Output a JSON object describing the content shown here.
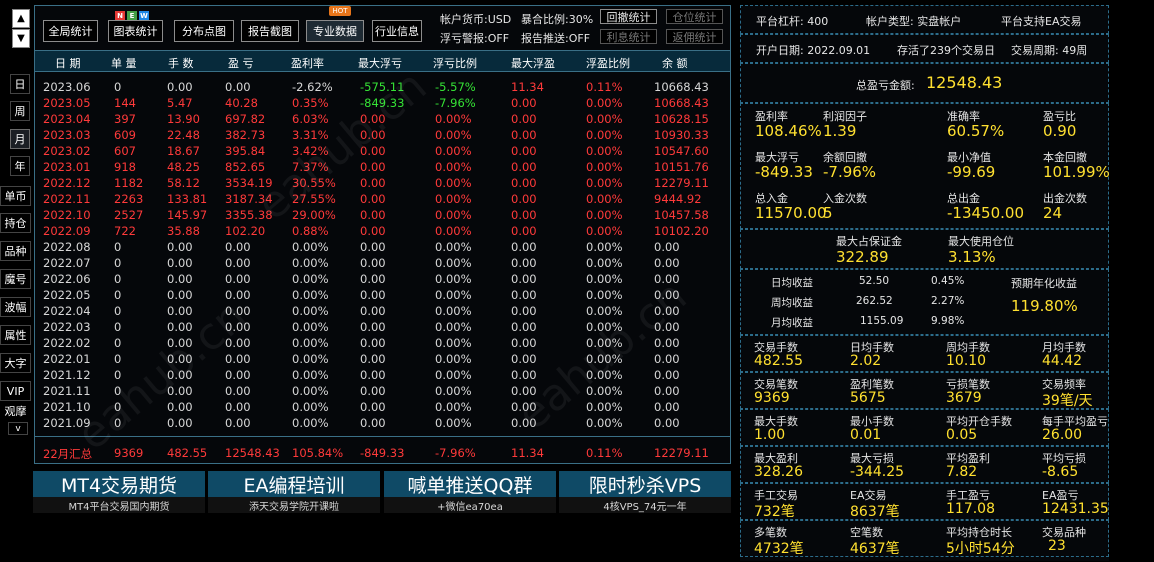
{
  "nav": {
    "up": "▲",
    "down": "▼",
    "period": [
      "日",
      "周",
      "月",
      "年"
    ],
    "tools": [
      "单币",
      "持仓",
      "品种",
      "魔号",
      "波幅",
      "属性",
      "大字",
      "VIP",
      "观摩"
    ],
    "more": "v"
  },
  "toolbar": {
    "buttons": [
      "全局统计",
      "图表统计",
      "分布点图",
      "报告截图",
      "专业数据",
      "行业信息"
    ],
    "new_badge": [
      "N",
      "E",
      "W"
    ],
    "hot_badge": "HOT",
    "currency": "帐户货币:USD",
    "expose": "暴合比例:30%",
    "float_warn": "浮亏警报:OFF",
    "report_push": "报告推送:OFF",
    "btn_drawdown": "回撤统计",
    "btn_position": "仓位统计",
    "btn_interest": "利息统计",
    "btn_rebate": "返佣统计"
  },
  "table": {
    "headers": [
      "日 期",
      "单 量",
      "手 数",
      "盈 亏",
      "盈利率",
      "最大浮亏",
      "浮亏比例",
      "最大浮盈",
      "浮盈比例",
      "余 额"
    ],
    "rows": [
      [
        "2023.06",
        "0",
        "0.00",
        "0.00",
        "-2.62%",
        "-575.11",
        "-5.57%",
        "11.34",
        "0.11%",
        "10668.43"
      ],
      [
        "2023.05",
        "144",
        "5.47",
        "40.28",
        "0.35%",
        "-849.33",
        "-7.96%",
        "0.00",
        "0.00%",
        "10668.43"
      ],
      [
        "2023.04",
        "397",
        "13.90",
        "697.82",
        "6.03%",
        "0.00",
        "0.00%",
        "0.00",
        "0.00%",
        "10628.15"
      ],
      [
        "2023.03",
        "609",
        "22.48",
        "382.73",
        "3.31%",
        "0.00",
        "0.00%",
        "0.00",
        "0.00%",
        "10930.33"
      ],
      [
        "2023.02",
        "607",
        "18.67",
        "395.84",
        "3.42%",
        "0.00",
        "0.00%",
        "0.00",
        "0.00%",
        "10547.60"
      ],
      [
        "2023.01",
        "918",
        "48.25",
        "852.65",
        "7.37%",
        "0.00",
        "0.00%",
        "0.00",
        "0.00%",
        "10151.76"
      ],
      [
        "2022.12",
        "1182",
        "58.12",
        "3534.19",
        "30.55%",
        "0.00",
        "0.00%",
        "0.00",
        "0.00%",
        "12279.11"
      ],
      [
        "2022.11",
        "2263",
        "133.81",
        "3187.34",
        "27.55%",
        "0.00",
        "0.00%",
        "0.00",
        "0.00%",
        "9444.92"
      ],
      [
        "2022.10",
        "2527",
        "145.97",
        "3355.38",
        "29.00%",
        "0.00",
        "0.00%",
        "0.00",
        "0.00%",
        "10457.58"
      ],
      [
        "2022.09",
        "722",
        "35.88",
        "102.20",
        "0.88%",
        "0.00",
        "0.00%",
        "0.00",
        "0.00%",
        "10102.20"
      ],
      [
        "2022.08",
        "0",
        "0.00",
        "0.00",
        "0.00%",
        "0.00",
        "0.00%",
        "0.00",
        "0.00%",
        "0.00"
      ],
      [
        "2022.07",
        "0",
        "0.00",
        "0.00",
        "0.00%",
        "0.00",
        "0.00%",
        "0.00",
        "0.00%",
        "0.00"
      ],
      [
        "2022.06",
        "0",
        "0.00",
        "0.00",
        "0.00%",
        "0.00",
        "0.00%",
        "0.00",
        "0.00%",
        "0.00"
      ],
      [
        "2022.05",
        "0",
        "0.00",
        "0.00",
        "0.00%",
        "0.00",
        "0.00%",
        "0.00",
        "0.00%",
        "0.00"
      ],
      [
        "2022.04",
        "0",
        "0.00",
        "0.00",
        "0.00%",
        "0.00",
        "0.00%",
        "0.00",
        "0.00%",
        "0.00"
      ],
      [
        "2022.03",
        "0",
        "0.00",
        "0.00",
        "0.00%",
        "0.00",
        "0.00%",
        "0.00",
        "0.00%",
        "0.00"
      ],
      [
        "2022.02",
        "0",
        "0.00",
        "0.00",
        "0.00%",
        "0.00",
        "0.00%",
        "0.00",
        "0.00%",
        "0.00"
      ],
      [
        "2022.01",
        "0",
        "0.00",
        "0.00",
        "0.00%",
        "0.00",
        "0.00%",
        "0.00",
        "0.00%",
        "0.00"
      ],
      [
        "2021.12",
        "0",
        "0.00",
        "0.00",
        "0.00%",
        "0.00",
        "0.00%",
        "0.00",
        "0.00%",
        "0.00"
      ],
      [
        "2021.11",
        "0",
        "0.00",
        "0.00",
        "0.00%",
        "0.00",
        "0.00%",
        "0.00",
        "0.00%",
        "0.00"
      ],
      [
        "2021.10",
        "0",
        "0.00",
        "0.00",
        "0.00%",
        "0.00",
        "0.00%",
        "0.00",
        "0.00%",
        "0.00"
      ],
      [
        "2021.09",
        "0",
        "0.00",
        "0.00",
        "0.00%",
        "0.00",
        "0.00%",
        "0.00",
        "0.00%",
        "0.00"
      ]
    ],
    "summary": [
      "22月汇总",
      "9369",
      "482.55",
      "12548.43",
      "105.84%",
      "-849.33",
      "-7.96%",
      "11.34",
      "0.11%",
      "12279.11"
    ]
  },
  "promos": [
    {
      "title": "MT4交易期货",
      "sub": "MT4平台交易国内期货"
    },
    {
      "title": "EA编程培训",
      "sub": "添天交易学院开课啦"
    },
    {
      "title": "喊单推送QQ群",
      "sub": "+微信ea70ea"
    },
    {
      "title": "限时秒杀VPS",
      "sub": "4核VPS_74元一年"
    }
  ],
  "watermark": "eahub.cn",
  "right": {
    "leverage": "平台杠杆: 400",
    "account_type": "帐户类型: 实盘帐户",
    "platform": "平台支持EA交易",
    "open_date": "开户日期: 2022.09.01",
    "active_days": "存活了239个交易日",
    "cycle": "交易周期: 49周",
    "total_pl_label": "总盈亏金额:",
    "total_pl": "12548.43",
    "g1": [
      {
        "label": "盈利率",
        "value": "108.46%"
      },
      {
        "label": "利润因子",
        "value": "1.39"
      },
      {
        "label": "准确率",
        "value": "60.57%"
      },
      {
        "label": "盈亏比",
        "value": "0.90"
      },
      {
        "label": "最大浮亏",
        "value": "-849.33"
      },
      {
        "label": "余额回撤",
        "value": "-7.96%"
      },
      {
        "label": "最小净值",
        "value": "-99.69"
      },
      {
        "label": "本金回撤",
        "value": "101.99%"
      },
      {
        "label": "总入金",
        "value": "11570.00"
      },
      {
        "label": "入金次数",
        "value": "5"
      },
      {
        "label": "总出金",
        "value": "-13450.00"
      },
      {
        "label": "出金次数",
        "value": "24"
      }
    ],
    "margin": {
      "label": "最大占保证金",
      "value": "322.89"
    },
    "max_pos": {
      "label": "最大使用仓位",
      "value": "3.13%"
    },
    "income": [
      {
        "label": "日均收益",
        "amount": "52.50",
        "pct": "0.45%"
      },
      {
        "label": "周均收益",
        "amount": "262.52",
        "pct": "2.27%"
      },
      {
        "label": "月均收益",
        "amount": "1155.09",
        "pct": "9.98%"
      }
    ],
    "annual": {
      "label": "预期年化收益",
      "value": "119.80%"
    },
    "g2": [
      {
        "label": "交易手数",
        "value": "482.55"
      },
      {
        "label": "日均手数",
        "value": "2.02"
      },
      {
        "label": "周均手数",
        "value": "10.10"
      },
      {
        "label": "月均手数",
        "value": "44.42"
      },
      {
        "label": "交易笔数",
        "value": "9369"
      },
      {
        "label": "盈利笔数",
        "value": "5675"
      },
      {
        "label": "亏损笔数",
        "value": "3679"
      },
      {
        "label": "交易频率",
        "value": "39笔/天"
      },
      {
        "label": "最大手数",
        "value": "1.00"
      },
      {
        "label": "最小手数",
        "value": "0.01"
      },
      {
        "label": "平均开仓手数",
        "value": "0.05"
      },
      {
        "label": "每手平均盈亏",
        "value": "26.00"
      },
      {
        "label": "最大盈利",
        "value": "328.26"
      },
      {
        "label": "最大亏损",
        "value": "-344.25"
      },
      {
        "label": "平均盈利",
        "value": "7.82"
      },
      {
        "label": "平均亏损",
        "value": "-8.65"
      },
      {
        "label": "手工交易",
        "value": "732笔"
      },
      {
        "label": "EA交易",
        "value": "8637笔"
      },
      {
        "label": "手工盈亏",
        "value": "117.08"
      },
      {
        "label": "EA盈亏",
        "value": "12431.35"
      },
      {
        "label": "多笔数",
        "value": "4732笔"
      },
      {
        "label": "空笔数",
        "value": "4637笔"
      },
      {
        "label": "平均持仓时长",
        "value": "5小时54分"
      },
      {
        "label": "交易品种",
        "value": "23"
      }
    ]
  }
}
